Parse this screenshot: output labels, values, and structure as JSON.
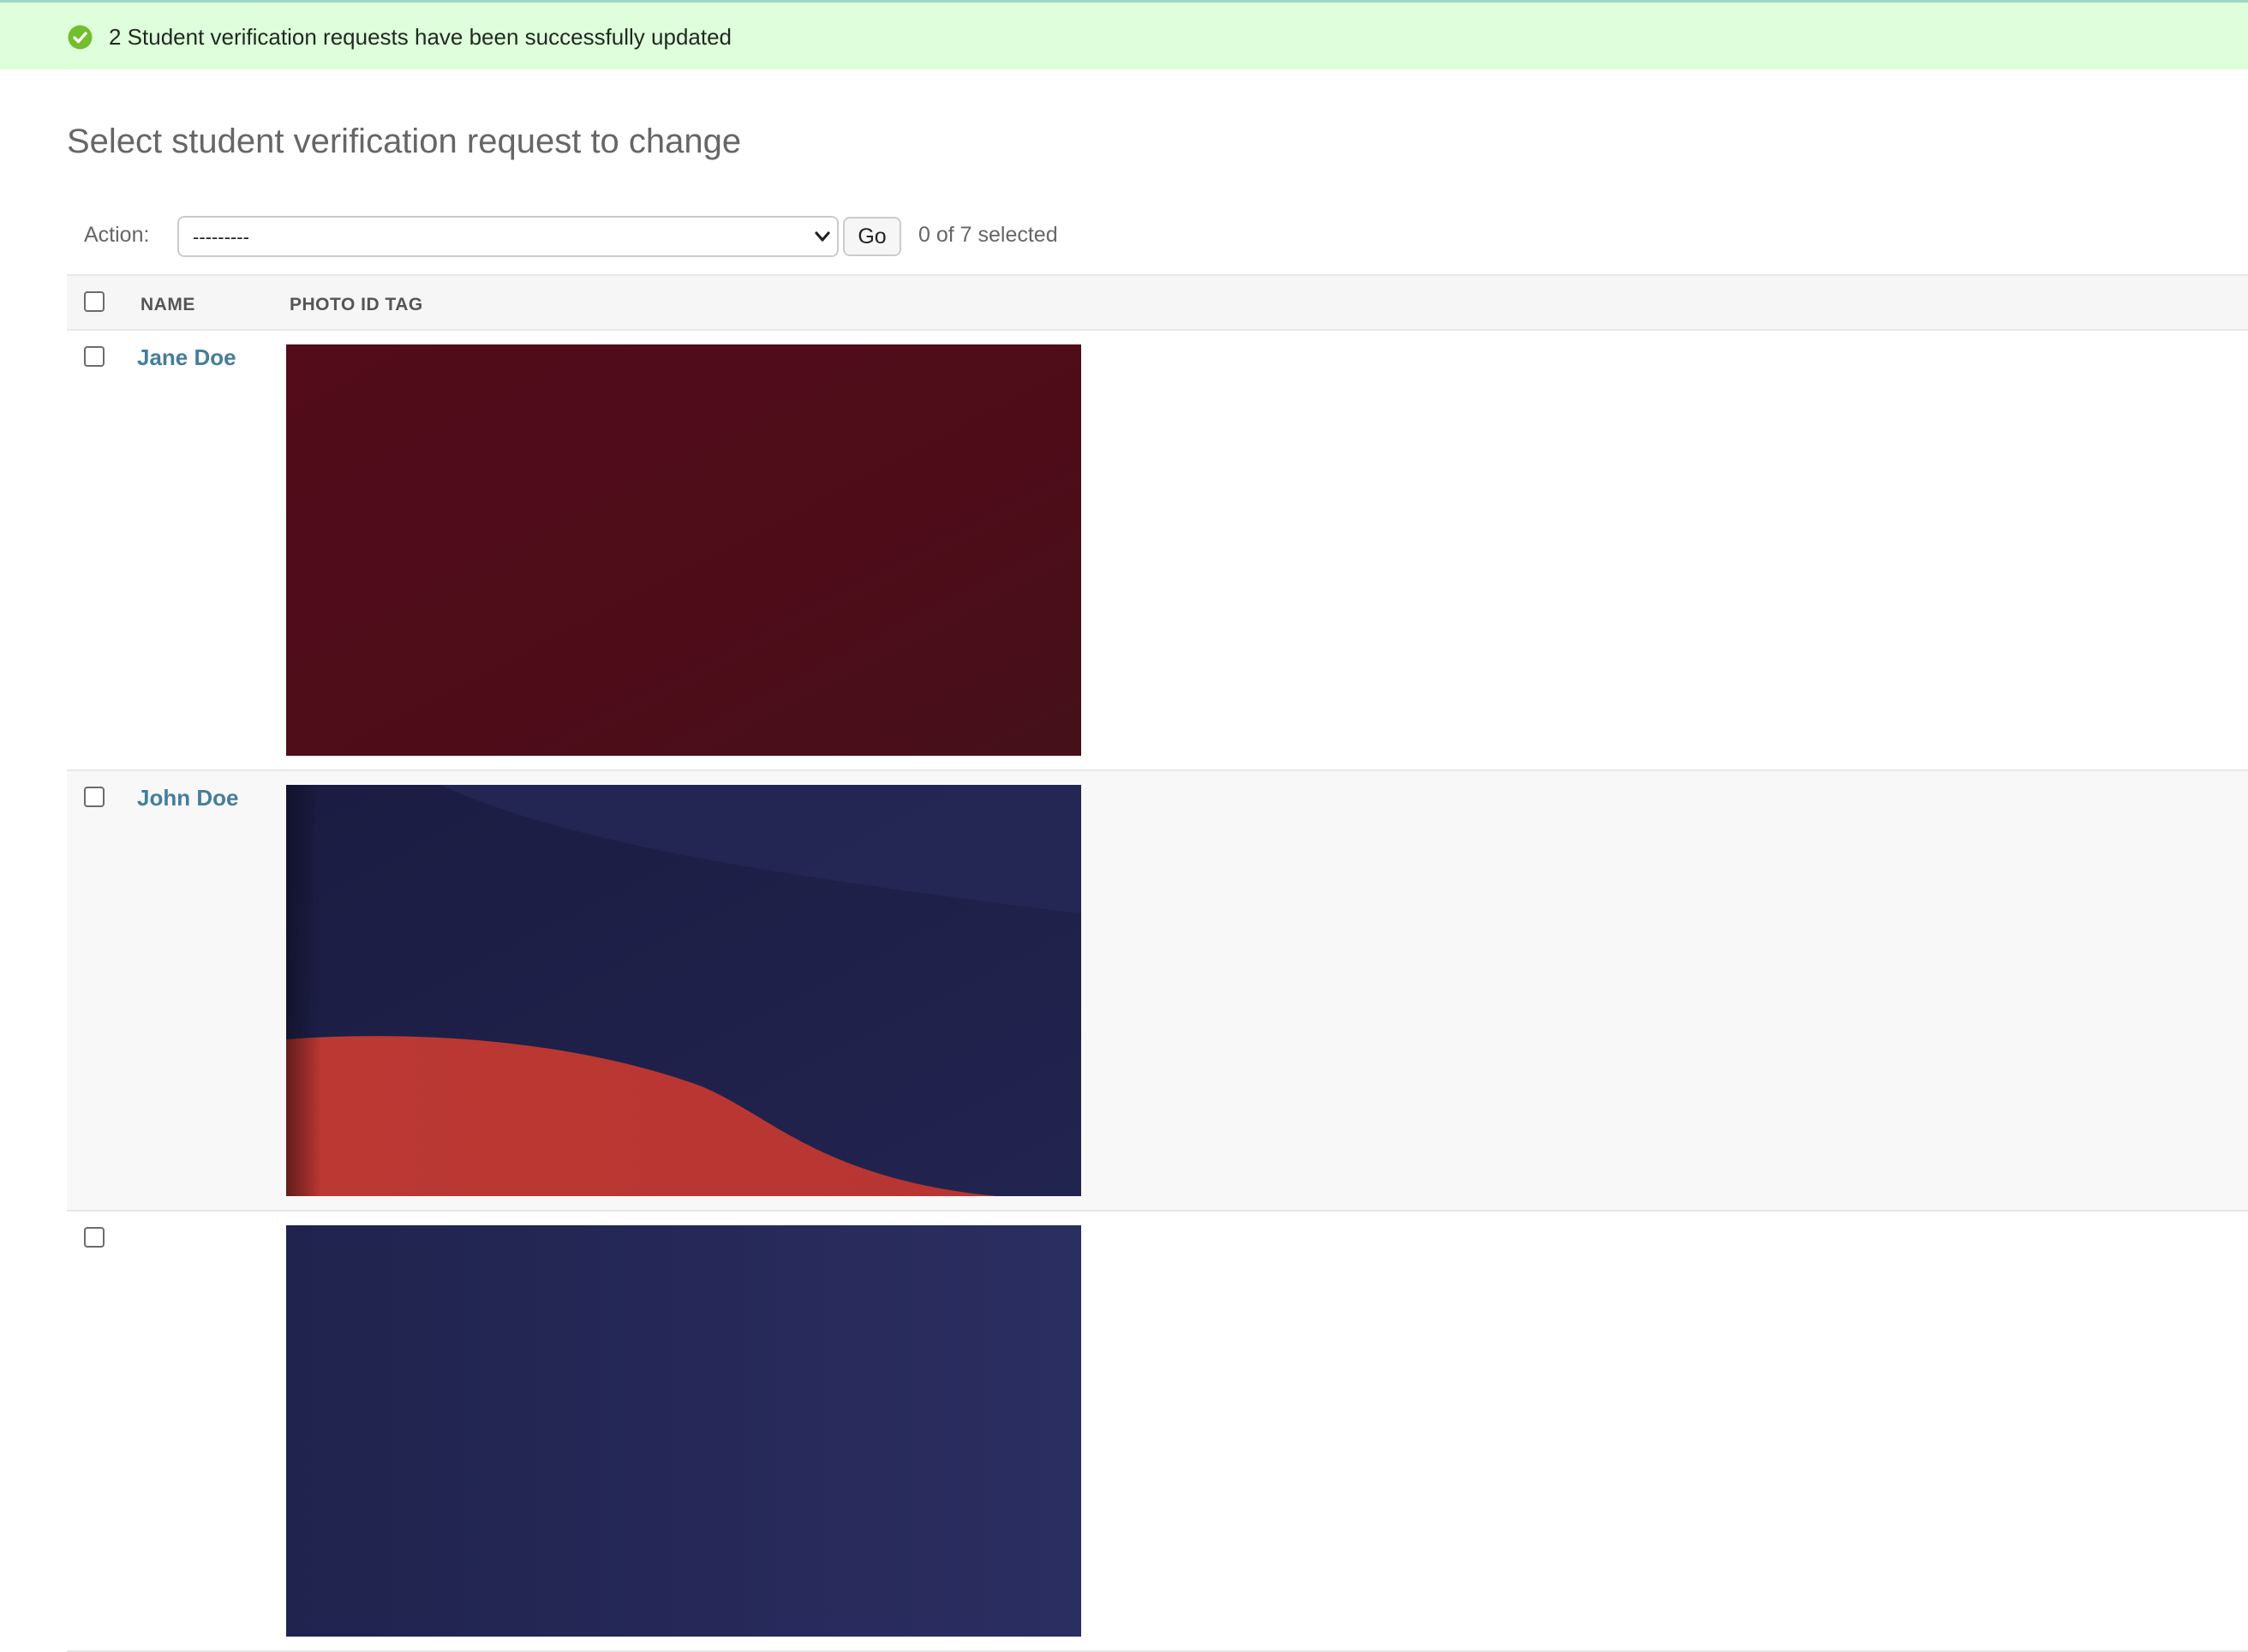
{
  "message": {
    "text": "2 Student verification requests have been successfully updated",
    "icon": "success-check-icon",
    "color": "#70bf2b"
  },
  "page": {
    "title": "Select student verification request to change"
  },
  "actions": {
    "label": "Action:",
    "select_value": "---------",
    "go_label": "Go",
    "selected_count": "0 of 7 selected"
  },
  "table": {
    "columns": [
      "NAME",
      "PHOTO ID TAG"
    ],
    "rows": [
      {
        "name": "Jane Doe",
        "photo": "dark red photo"
      },
      {
        "name": "John Doe",
        "photo": "navy and red wave photo"
      },
      {
        "name": "",
        "photo": "navy photo"
      }
    ]
  },
  "colors": {
    "link": "#447e9b",
    "success_bg": "#dfffdc",
    "header_bg": "#f6f6f6"
  }
}
